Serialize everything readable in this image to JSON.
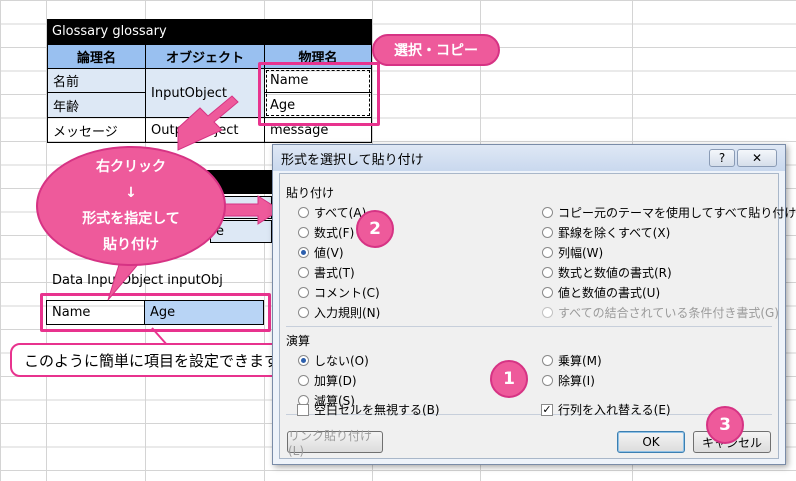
{
  "sheet": {
    "table1_title": "Glossary glossary",
    "headers": [
      "論理名",
      "オブジェクト",
      "物理名"
    ],
    "rows": [
      {
        "logical": "名前",
        "physical": "Name"
      },
      {
        "logical": "年齢",
        "physical": "Age"
      },
      {
        "logical": "メッセージ",
        "object": "OutputObject",
        "physical": "message"
      }
    ],
    "merged_object": "InputObject",
    "partial_a": "e",
    "partial_b": "e",
    "data_line": "Data InputObject inputObj",
    "pasted": [
      "Name",
      "Age"
    ]
  },
  "callouts": {
    "copy": "選択・コピー",
    "right_click_1": "右クリック",
    "arrow": "↓",
    "right_click_2": "形式を指定して",
    "right_click_3": "貼り付け",
    "note": "このように簡単に項目を設定できます。",
    "n1": "1",
    "n2": "2",
    "n3": "3"
  },
  "dialog": {
    "title": "形式を選択して貼り付け",
    "help": "?",
    "close": "✕",
    "paste_group": "貼り付け",
    "paste_left": [
      "すべて(A)",
      "数式(F)",
      "値(V)",
      "書式(T)",
      "コメント(C)",
      "入力規則(N)"
    ],
    "paste_right": [
      "コピー元のテーマを使用してすべて貼り付け(H)",
      "罫線を除くすべて(X)",
      "列幅(W)",
      "数式と数値の書式(R)",
      "値と数値の書式(U)",
      "すべての結合されている条件付き書式(G)"
    ],
    "calc_group": "演算",
    "calc_left": [
      "しない(O)",
      "加算(D)",
      "減算(S)"
    ],
    "calc_right": [
      "乗算(M)",
      "除算(I)"
    ],
    "skip_blanks": "空白セルを無視する(B)",
    "transpose": "行列を入れ替える(E)",
    "paste_link": "リンク貼り付け(L)",
    "ok": "OK",
    "cancel": "キャンセル"
  },
  "colors": {
    "accent": "#e8338e",
    "header": "#99c0f0",
    "selected": "#b8d4f5"
  }
}
